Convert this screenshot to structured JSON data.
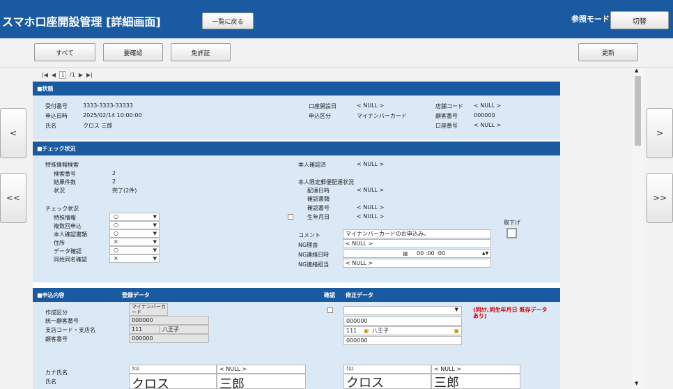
{
  "header": {
    "title": "スマホ口座開設管理 [詳細画面]",
    "back_button": "一覧に戻る",
    "mode": "参照モード",
    "switch_button": "切替"
  },
  "toolbar": {
    "all": "すべて",
    "need_check": "要確認",
    "license": "免許証",
    "refresh": "更新"
  },
  "pager": {
    "first": "|◀",
    "prev": "◀",
    "page": "1",
    "total": "/1",
    "next": "▶",
    "last": "▶|"
  },
  "nav": {
    "prev": "<",
    "next": ">",
    "first": "<<",
    "last": ">>"
  },
  "status": {
    "title": "■状態",
    "receipt_no_label": "受付番号",
    "receipt_no": "3333-3333-33333",
    "apply_date_label": "申込日時",
    "apply_date": "2025/02/14 10:00:00",
    "name_label": "氏名",
    "name": "クロス 三郎",
    "open_date_label": "口座開設日",
    "open_date": "< NULL >",
    "apply_type_label": "申込区分",
    "apply_type": "マイナンバーカード",
    "shop_code_label": "店舗コード",
    "shop_code": "< NULL >",
    "customer_no_label": "顧客番号",
    "customer_no": "000000",
    "account_no_label": "口座番号",
    "account_no": "< NULL >"
  },
  "check": {
    "title": "■チェック状況",
    "special_search": "特殊情報検索",
    "search_no_label": "検索番号",
    "search_no": "2",
    "result_count_label": "結果件数",
    "result_count": "2",
    "state_label": "状況",
    "state": "完了(2件)",
    "check_status": "チェック状況",
    "rows": [
      {
        "label": "特殊情報",
        "value": "○"
      },
      {
        "label": "複数回申込",
        "value": "○"
      },
      {
        "label": "本人確認書類",
        "value": "○"
      },
      {
        "label": "住所",
        "value": "×"
      },
      {
        "label": "データ確認",
        "value": "○"
      },
      {
        "label": "同姓同名確認",
        "value": "×"
      }
    ],
    "identity_label": "本人確認済",
    "identity": "< NULL >",
    "mail_status": "本人限定郵便配達状況",
    "delivery_date_label": "配達日時",
    "delivery_date": "< NULL >",
    "doc_label": "確認書類",
    "confirm_no_label": "確認番号",
    "confirm_no": "< NULL >",
    "birth_label": "生年月日",
    "birth": "< NULL >",
    "comment_label": "コメント",
    "comment": "マイナンバーカードのお申込み。",
    "ng_reason_label": "NG理由",
    "ng_reason": "< NULL >",
    "ng_date_label": "NG連絡日時",
    "ng_time": "00 :00 :00",
    "ng_person_label": "NG連絡担当",
    "ng_person": "< NULL >",
    "withdraw_label": "取下げ"
  },
  "apply": {
    "title": "■申込内容",
    "reg_data": "登録データ",
    "confirm": "確認",
    "mod_data": "修正データ",
    "create_type_label": "作成区分",
    "create_type": "マイナンバーカード",
    "unified_no_label": "統一顧客番号",
    "unified_no": "000000",
    "branch_label": "支店コード・支店名",
    "branch_code": "111",
    "branch_name": "八王子",
    "customer_no_label": "顧客番号",
    "customer_no": "000000",
    "mod_unified_no": "000000",
    "mod_branch_code": "111",
    "mod_branch_name": "八王子",
    "mod_customer_no": "000000",
    "warning": "(同ｶﾅ､同生年月日 既存データあり)",
    "kana_label": "カナ氏名",
    "name_label": "氏名",
    "kana_last": "ｸﾛｽ",
    "kana_first": "< NULL >",
    "name_last": "クロス",
    "name_first": "三郎",
    "mod_kana_last": "ｸﾛｽ",
    "mod_kana_first": "< NULL >",
    "mod_name_last": "クロス",
    "mod_name_first": "三郎"
  }
}
